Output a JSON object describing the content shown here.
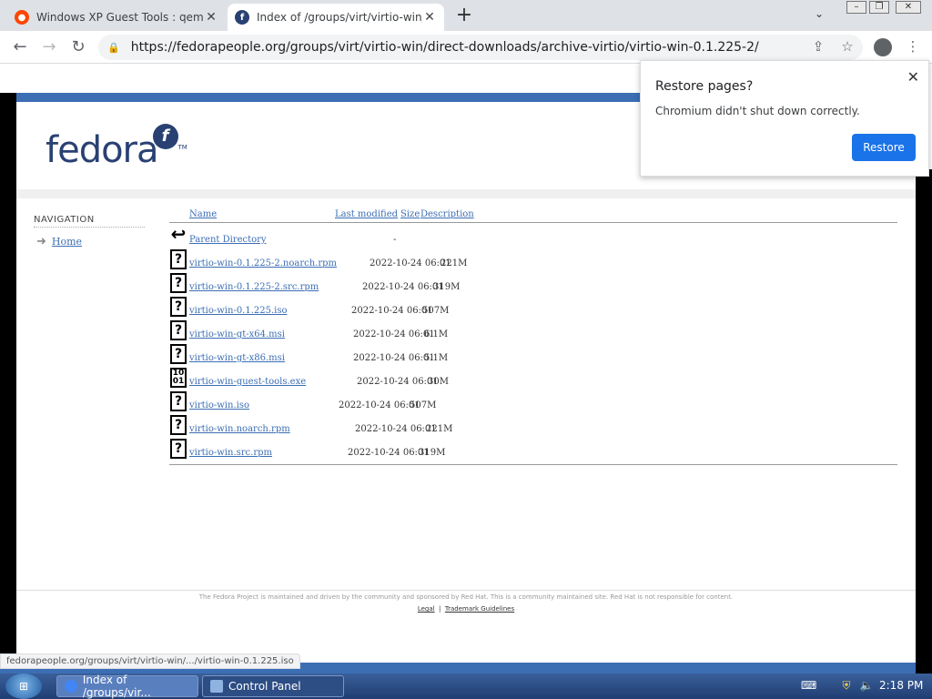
{
  "browser": {
    "tabs": [
      {
        "title": "Windows XP Guest Tools : qemu_kvm",
        "favicon": "reddit-icon",
        "active": false
      },
      {
        "title": "Index of /groups/virt/virtio-win/direct-downloads",
        "favicon": "fedora-icon",
        "active": true
      }
    ],
    "new_tab": "+",
    "url": "https://fedorapeople.org/groups/virt/virtio-win/direct-downloads/archive-virtio/virtio-win-0.1.225-2/",
    "status_url": "fedorapeople.org/groups/virt/virtio-win/.../virtio-win-0.1.225.iso"
  },
  "popup": {
    "title": "Restore pages?",
    "message": "Chromium didn't shut down correctly.",
    "button": "Restore",
    "close": "✕"
  },
  "page": {
    "logo_text": "fedora",
    "logo_badge": "f",
    "logo_tm": "TM",
    "nav_heading": "NAVIGATION",
    "nav_home": "Home",
    "columns": {
      "name": "Name",
      "modified": "Last modified",
      "size": "Size",
      "description": "Description"
    },
    "parent": {
      "name": "Parent Directory",
      "size": "-"
    },
    "files": [
      {
        "name": "virtio-win-0.1.225-2.noarch.rpm",
        "modified": "2022-10-24 06:01",
        "size": "221M",
        "icon": "file-unknown-icon"
      },
      {
        "name": "virtio-win-0.1.225-2.src.rpm",
        "modified": "2022-10-24 06:01",
        "size": "319M",
        "icon": "file-unknown-icon"
      },
      {
        "name": "virtio-win-0.1.225.iso",
        "modified": "2022-10-24 06:01",
        "size": "507M",
        "icon": "file-unknown-icon"
      },
      {
        "name": "virtio-win-gt-x64.msi",
        "modified": "2022-10-24 06:01",
        "size": "6.1M",
        "icon": "file-unknown-icon"
      },
      {
        "name": "virtio-win-gt-x86.msi",
        "modified": "2022-10-24 06:01",
        "size": "5.1M",
        "icon": "file-unknown-icon"
      },
      {
        "name": "virtio-win-guest-tools.exe",
        "modified": "2022-10-24 06:01",
        "size": "30M",
        "icon": "binary-file-icon"
      },
      {
        "name": "virtio-win.iso",
        "modified": "2022-10-24 06:01",
        "size": "507M",
        "icon": "file-unknown-icon"
      },
      {
        "name": "virtio-win.noarch.rpm",
        "modified": "2022-10-24 06:01",
        "size": "221M",
        "icon": "file-unknown-icon"
      },
      {
        "name": "virtio-win.src.rpm",
        "modified": "2022-10-24 06:01",
        "size": "319M",
        "icon": "file-unknown-icon"
      }
    ],
    "footer_text": "The Fedora Project is maintained and driven by the community and sponsored by Red Hat. This is a community maintained site. Red Hat is not responsible for content.",
    "footer_legal": "Legal",
    "footer_trademark": "Trademark Guidelines"
  },
  "taskbar": {
    "tasks": [
      {
        "label": "Index of /groups/vir...",
        "icon": "chromium-icon"
      },
      {
        "label": "Control Panel",
        "icon": "control-panel-icon"
      }
    ],
    "clock": "2:18 PM"
  },
  "colors": {
    "fedora_blue": "#3c6eb4",
    "fedora_dark": "#294172",
    "restore_button": "#1a73e8",
    "taskbar": "#1f3d72"
  }
}
